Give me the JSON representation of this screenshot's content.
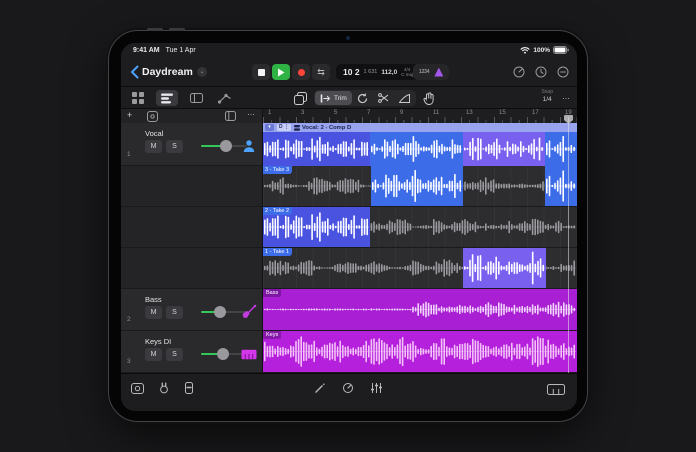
{
  "status_bar": {
    "time": "9:41 AM",
    "date": "Tue 1 Apr",
    "battery": "100%"
  },
  "toolbar": {
    "project_title": "Daydream",
    "lcd": {
      "position": "10 2",
      "ticks": "1 631",
      "tempo": "112,0",
      "time_sig": "4/4",
      "key": "C maj"
    },
    "count_in": "1234"
  },
  "edit_bar": {
    "trim_label": "Trim",
    "snap_label": "Snap",
    "snap_value": "1/4",
    "more": "…"
  },
  "track_panel": {
    "add": "+",
    "more": "…"
  },
  "tracks": [
    {
      "number": "1",
      "name": "Vocal",
      "mute": "M",
      "solo": "S"
    },
    {
      "number": "2",
      "name": "Bass",
      "mute": "M",
      "solo": "S"
    },
    {
      "number": "3",
      "name": "Keys DI",
      "mute": "M",
      "solo": "S"
    }
  ],
  "arrange": {
    "ruler": [
      "1",
      "3",
      "5",
      "7",
      "9",
      "11",
      "13",
      "15",
      "17",
      "19"
    ],
    "comp_region": {
      "chevron": "▾",
      "badge": "D ⋮",
      "title": "Vocal: 2 - Comp D"
    },
    "take_lanes": [
      {
        "label": "3 - Take 3"
      },
      {
        "label": "2 - Take 2"
      },
      {
        "label": "1 - Take 1"
      }
    ],
    "regions": {
      "bass_label": "Bass",
      "keys_label": "Keys"
    }
  },
  "colors": {
    "play_green": "#2fb344",
    "record_red": "#ff453a",
    "region_blue": "#3d6ce9",
    "region_indigo": "#4a52e0",
    "region_violet": "#7a60ee",
    "comp_strip": "#98a5ee",
    "region_magenta_bass": "#a81fd4",
    "region_magenta_keys": "#b520dd",
    "metronome_purple": "#a257e8",
    "vocal_icon_blue": "#4da3ff",
    "slider_green": "#34c759"
  }
}
